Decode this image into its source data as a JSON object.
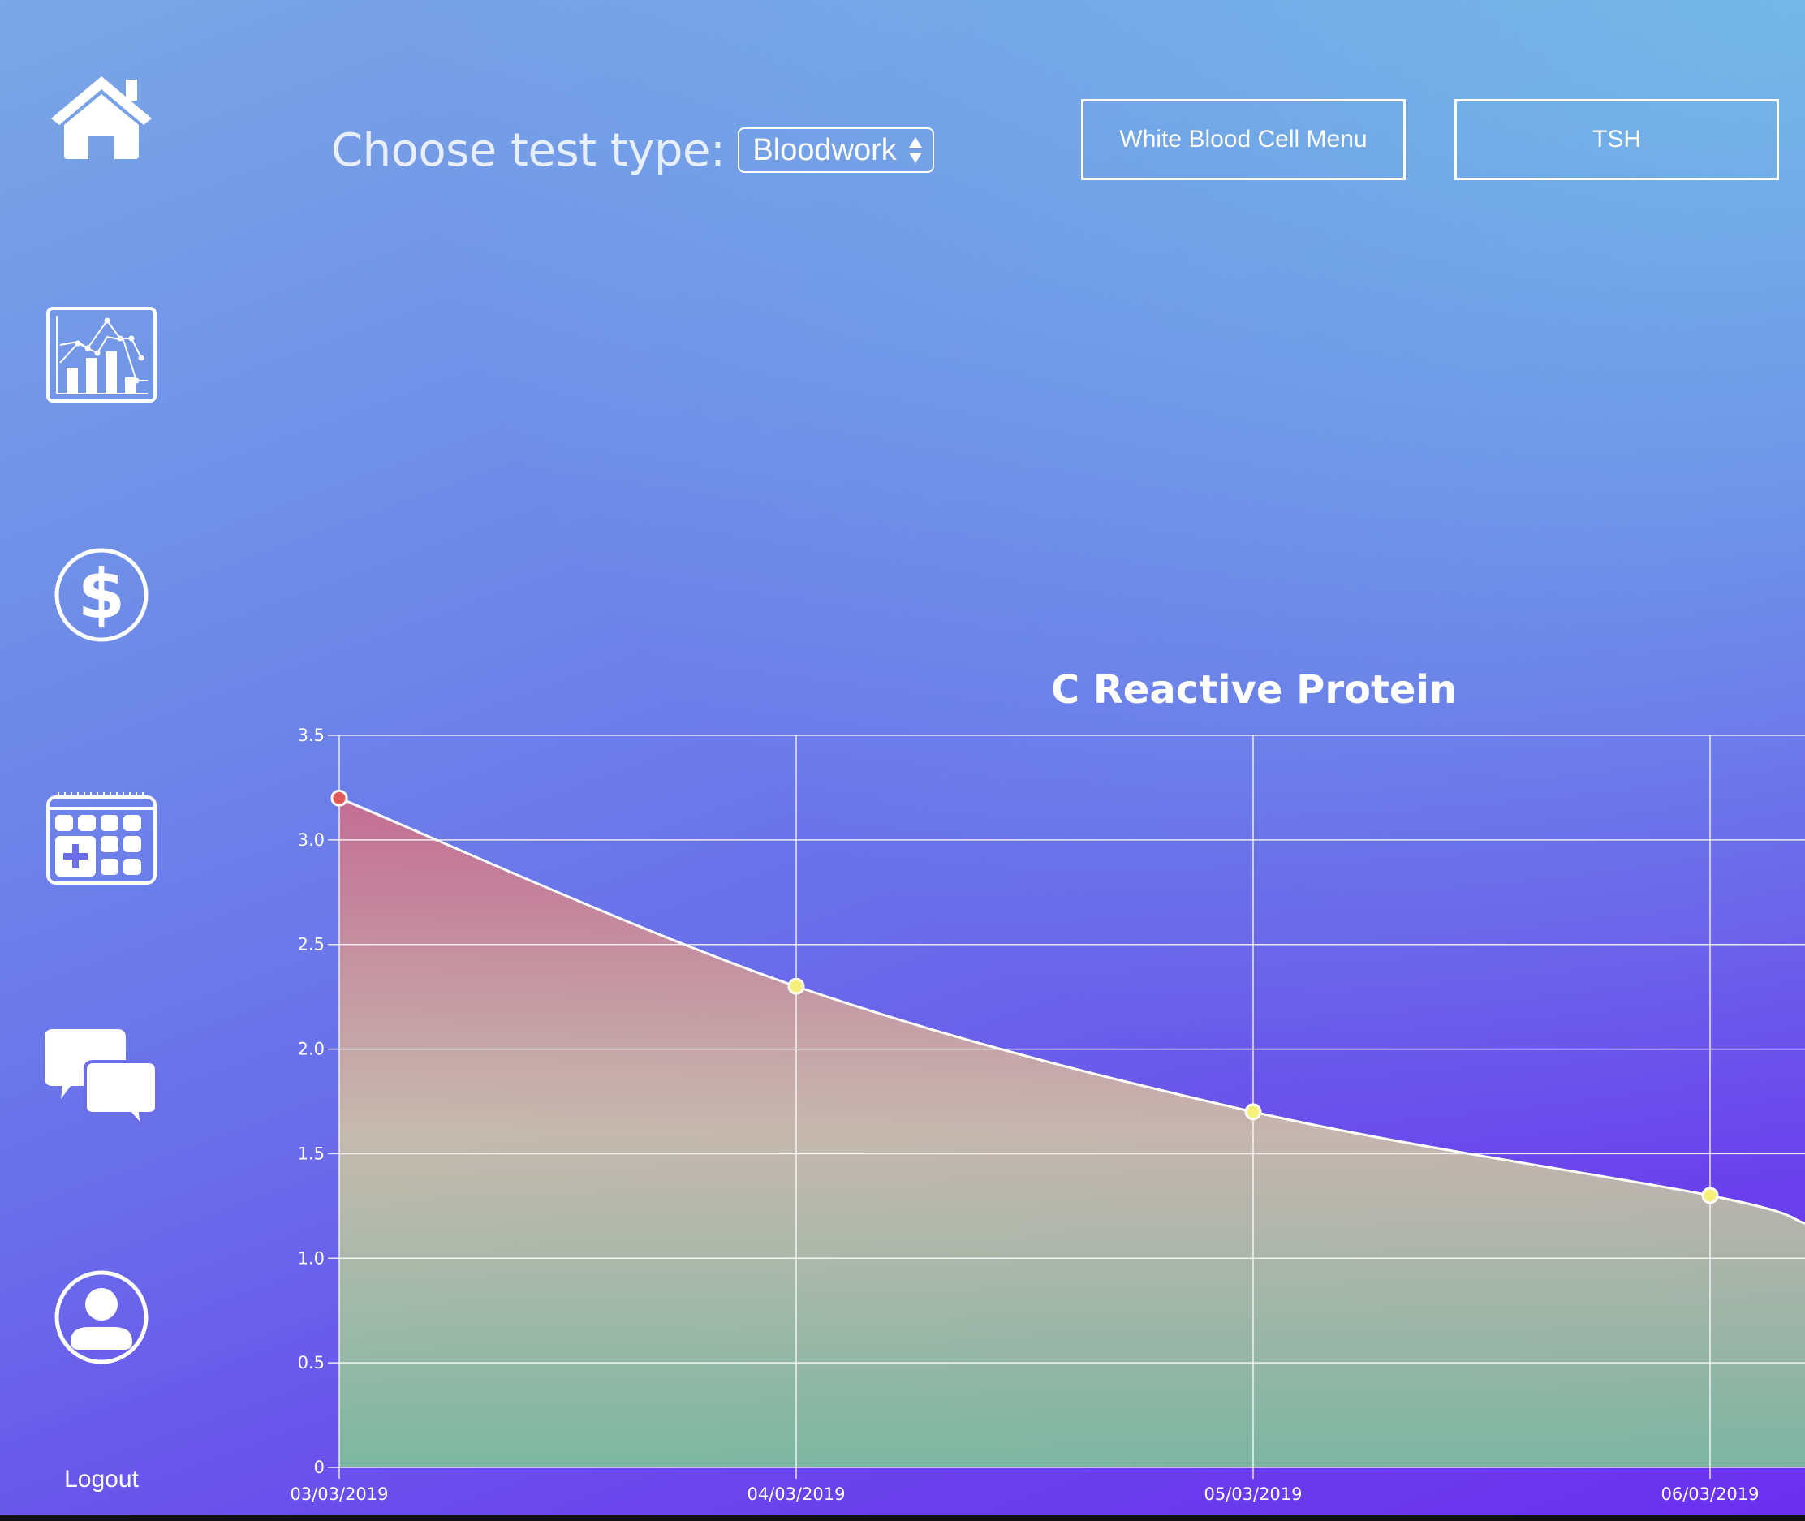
{
  "sidebar": {
    "items": [
      {
        "icon": "home-icon"
      },
      {
        "icon": "charts-icon"
      },
      {
        "icon": "dollar-icon"
      },
      {
        "icon": "calendar-medical-icon"
      },
      {
        "icon": "chat-bubbles-icon"
      },
      {
        "icon": "user-profile-icon"
      }
    ],
    "logout_label": "Logout"
  },
  "header": {
    "test_type_label": "Choose test type:",
    "test_type_value": "Bloodwork",
    "buttons": [
      {
        "label": "White Blood Cell Menu"
      },
      {
        "label": "TSH"
      }
    ]
  },
  "colors": {
    "line": "#ffffff",
    "point_high": "#e05a5a",
    "point_normal": "#f4f07a",
    "fill_top": "#d46a84",
    "fill_mid": "#c8c0a8",
    "fill_bottom": "#7ec49a"
  },
  "chart_data": {
    "type": "area",
    "title": "C Reactive Protein",
    "x": [
      "03/03/2019",
      "04/03/2019",
      "05/03/2019",
      "06/03/2019"
    ],
    "y_ticks": [
      "0",
      "0.5",
      "1.0",
      "1.5",
      "2.0",
      "2.5",
      "3.0",
      "3.5"
    ],
    "ylim": [
      0,
      3.5
    ],
    "series": [
      {
        "values": [
          3.2,
          2.3,
          1.7,
          1.3
        ]
      }
    ],
    "grid": true,
    "xlabel": "",
    "ylabel": ""
  }
}
